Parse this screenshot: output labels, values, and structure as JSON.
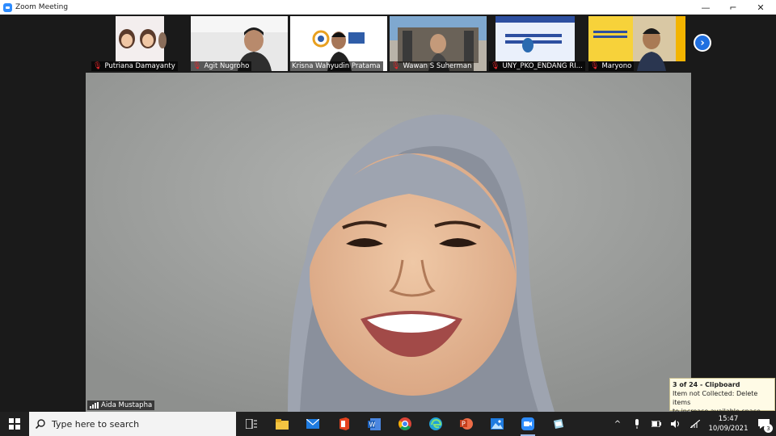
{
  "window": {
    "title": "Zoom Meeting",
    "controls": {
      "minimize": "—",
      "maximize": "⌐",
      "close": "✕"
    }
  },
  "gallery": {
    "participants": [
      {
        "name": "Putriana Damayanty",
        "muted": true
      },
      {
        "name": "Agit Nugroho",
        "muted": true
      },
      {
        "name": "Krisna Wahyudin Pratama",
        "muted": false
      },
      {
        "name": "Wawan S Suherman",
        "muted": true
      },
      {
        "name": "UNY_PKO_ENDANG RI...",
        "muted": true
      },
      {
        "name": "Maryono",
        "muted": true
      }
    ],
    "next_label": "›"
  },
  "speaker": {
    "name": "Aida Mustapha"
  },
  "clipboard": {
    "header": "3 of 24 - Clipboard",
    "line1": "Item not Collected: Delete items",
    "line2": "to increase available space"
  },
  "taskbar": {
    "search_placeholder": "Type here to search",
    "apps": [
      "task-view",
      "file-explorer",
      "mail",
      "office",
      "word",
      "chrome",
      "edge",
      "powerpoint",
      "photos",
      "zoom",
      "app"
    ],
    "notification_count": "3"
  },
  "clock": {
    "time": "15:47",
    "date": "10/09/2021"
  },
  "colors": {
    "accent": "#2d8cff",
    "mute": "#e0272b",
    "next_button": "#1f6fe0"
  }
}
